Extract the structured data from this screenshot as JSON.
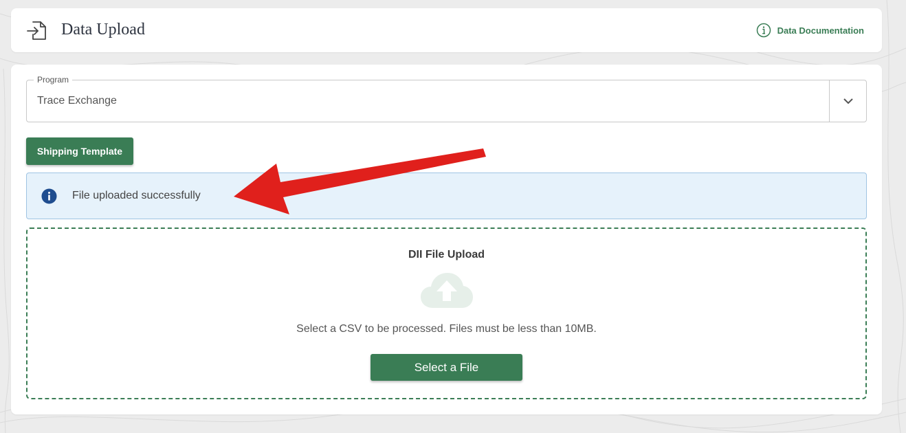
{
  "header": {
    "title": "Data Upload",
    "doc_link_label": "Data Documentation"
  },
  "program": {
    "legend": "Program",
    "value": "Trace Exchange"
  },
  "buttons": {
    "shipping_template": "Shipping Template",
    "select_file": "Select a File"
  },
  "alert": {
    "message": "File uploaded successfully"
  },
  "upload": {
    "title": "DII File Upload",
    "description": "Select a CSV to be processed. Files must be less than 10MB."
  },
  "colors": {
    "brand_green": "#3a7d55",
    "alert_bg": "#e6f2fb",
    "alert_icon": "#1f4d8f",
    "annotation_red": "#e0201c"
  },
  "icons": {
    "header": "file-import-icon",
    "doc_link": "info-circle-icon",
    "select": "chevron-down-icon",
    "alert": "info-filled-icon",
    "upload": "cloud-upload-icon"
  }
}
